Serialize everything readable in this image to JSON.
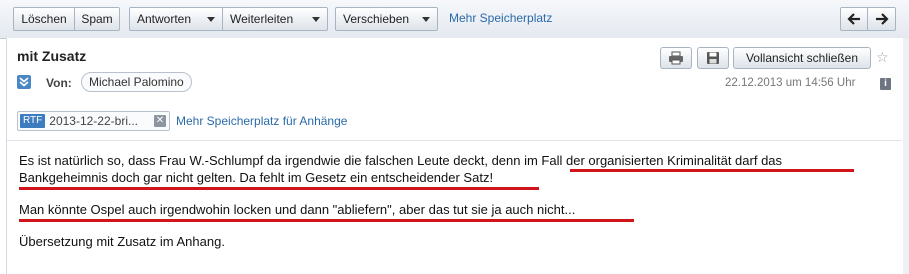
{
  "toolbar": {
    "delete_label": "Löschen",
    "spam_label": "Spam",
    "reply_label": "Antworten",
    "forward_label": "Weiterleiten",
    "move_label": "Verschieben",
    "more_storage_label": "Mehr Speicherplatz",
    "prev_icon": "arrow-left-icon",
    "next_icon": "arrow-right-icon"
  },
  "header": {
    "subject": "mit Zusatz",
    "print_icon": "print-icon",
    "save_icon": "save-icon",
    "fullview_label": "Vollansicht schließen",
    "star_icon": "star-icon",
    "from_label": "Von:",
    "from_name": "Michael Palomino",
    "date": "22.12.2013 um 14:56 Uhr",
    "info_icon": "info-icon"
  },
  "attachment": {
    "type_badge": "RTF",
    "filename": "2013-12-22-bri...",
    "remove_icon": "close-icon",
    "more_storage_link": "Mehr Speicherplatz für Anhänge"
  },
  "body": {
    "line1": "Es ist natürlich so, dass Frau W.-Schlumpf da irgendwie die falschen Leute deckt, denn im Fall der organisierten Kriminalität darf das",
    "line2": "Bankgeheimnis doch gar nicht gelten. Da fehlt im Gesetz ein entscheidender Satz!",
    "line3": "Man könnte Ospel auch irgendwohin locken und dann \"abliefern\", aber das tut sie ja auch nicht...",
    "line4": "Übersetzung mit Zusatz im Anhang."
  },
  "colors": {
    "link": "#2a6aa8",
    "underline_annotation": "#d0141c",
    "rtf_badge": "#3e7cc0"
  }
}
